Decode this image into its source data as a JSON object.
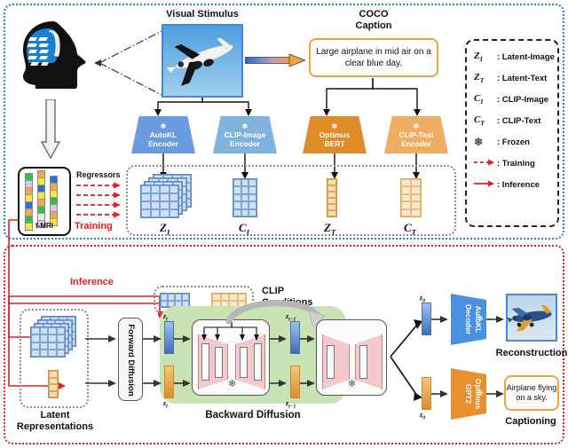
{
  "panels": {
    "training_label": "Training",
    "inference_label": "Inference",
    "regressors_label": "Regressors"
  },
  "top": {
    "visual_stimulus_title": "Visual Stimulus",
    "coco_title_line1": "COCO",
    "coco_title_line2": "Caption",
    "caption_text": "Large airplane in mid air on a clear blue day.",
    "brain_icon": "brain-head-icon",
    "stimulus_image_alt": "airplane-photo",
    "gradient_arrow": "gradient-arrow-icon"
  },
  "encoders": [
    {
      "name": "autokl-encoder",
      "line1": "AutoKL",
      "line2": "Encoder",
      "color": "#6a9be0",
      "frozen": true
    },
    {
      "name": "clip-image-encoder",
      "line1": "CLIP-Image",
      "line2": "Encoder",
      "color": "#7fb2dd",
      "frozen": true
    },
    {
      "name": "optimus-bert",
      "line1": "Optimus",
      "line2": "BERT",
      "color": "#e08c28",
      "frozen": true
    },
    {
      "name": "clip-text-encoder",
      "line1": "CLIP-Text",
      "line2": "Encoder",
      "color": "#f0ae62",
      "frozen": true
    }
  ],
  "latents": [
    {
      "name": "z-i",
      "symbol": "Z",
      "sub": "I"
    },
    {
      "name": "c-i",
      "symbol": "C",
      "sub": "I"
    },
    {
      "name": "z-t",
      "symbol": "Z",
      "sub": "T"
    },
    {
      "name": "c-t",
      "symbol": "C",
      "sub": "T"
    }
  ],
  "fmri": {
    "label": "f-MRI"
  },
  "legend": {
    "rows": [
      {
        "sym": "Z",
        "sub": "I",
        "text": ": Latent-Image",
        "kind": "sym"
      },
      {
        "sym": "Z",
        "sub": "T",
        "text": ": Latent-Text",
        "kind": "sym"
      },
      {
        "sym": "C",
        "sub": "I",
        "text": ": CLIP-Image",
        "kind": "sym"
      },
      {
        "sym": "C",
        "sub": "T",
        "text": ": CLIP-Text",
        "kind": "sym"
      },
      {
        "sym": "",
        "sub": "",
        "text": ": Frozen",
        "kind": "snow"
      },
      {
        "sym": "",
        "sub": "",
        "text": ": Training",
        "kind": "dash"
      },
      {
        "sym": "",
        "sub": "",
        "text": ": Inference",
        "kind": "solid"
      }
    ]
  },
  "bottom": {
    "latent_rep_line1": "Latent",
    "latent_rep_line2": "Representations",
    "forward_diffusion": "Forward Diffusion",
    "backward_diffusion": "Backward Diffusion",
    "clip_cond_line1": "CLIP",
    "clip_cond_line2": "Conditions",
    "reconstruction_label": "Reconstruction",
    "captioning_label": "Captioning",
    "output_caption": "Airplane flying on a sky.",
    "decoder": {
      "name": "autokl-decoder",
      "line1": "AutoKL",
      "line2": "Decoder",
      "color": "#4a8fe0"
    },
    "gpt": {
      "name": "optimus-gpt2",
      "line1": "Optimus",
      "line2": "GPT2",
      "color": "#e8902f"
    },
    "step_labels": {
      "zt": "z",
      "zt_sub": "t",
      "ztm1_sub": "t−1",
      "z0_sub": "0"
    },
    "reconstruction_alt": "reconstructed-airplane-photo"
  },
  "colors": {
    "training_blue": "#2a7de1",
    "inference_red": "#e81c1c",
    "orange_accent": "#f0a33c",
    "green_band": "#c9e3b4"
  }
}
